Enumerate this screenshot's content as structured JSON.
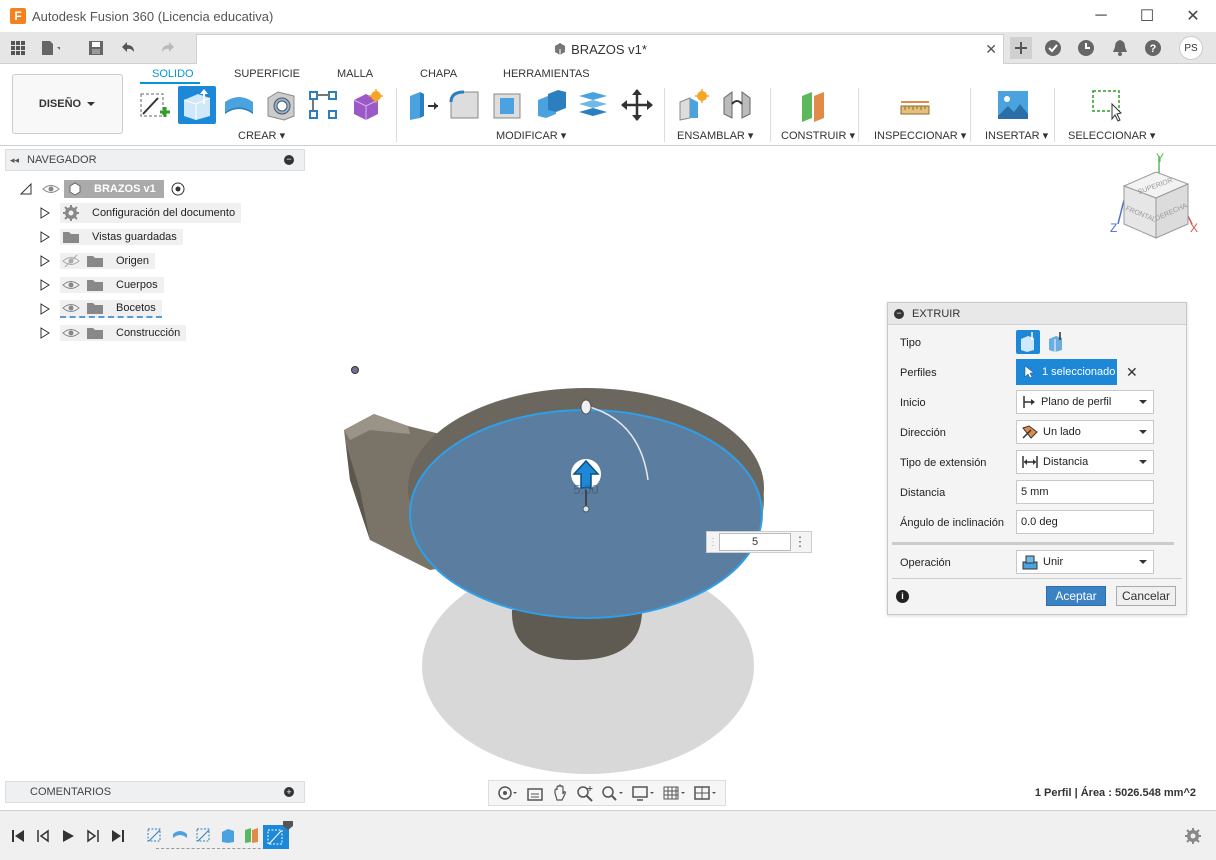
{
  "window": {
    "title": "Autodesk Fusion 360 (Licencia educativa)",
    "logo_letter": "F",
    "minimize": "─",
    "maximize": "☐",
    "close": "✕"
  },
  "tabbar": {
    "doc_title": "BRAZOS v1*",
    "user_initials": "PS"
  },
  "toolbar": {
    "design_label": "DISEÑO",
    "workspace_tabs": [
      "SOLIDO",
      "SUPERFICIE",
      "MALLA",
      "CHAPA",
      "HERRAMIENTAS"
    ],
    "groups": {
      "crear": "CREAR",
      "modificar": "MODIFICAR",
      "ensamblar": "ENSAMBLAR",
      "construir": "CONSTRUIR",
      "inspeccionar": "INSPECCIONAR",
      "insertar": "INSERTAR",
      "seleccionar": "SELECCIONAR"
    }
  },
  "browser": {
    "header": "NAVEGADOR",
    "root": "BRAZOS v1",
    "items": [
      {
        "label": "Configuración del documento"
      },
      {
        "label": "Vistas guardadas"
      },
      {
        "label": "Origen"
      },
      {
        "label": "Cuerpos"
      },
      {
        "label": "Bocetos"
      },
      {
        "label": "Construcción"
      }
    ]
  },
  "comments": {
    "header": "COMENTARIOS"
  },
  "viewcube": {
    "top": "SUPERIOR",
    "front": "FRONTAL",
    "right": "DERECHA",
    "axis_x": "X",
    "axis_y": "Y",
    "axis_z": "Z"
  },
  "canvas": {
    "value_input": "5",
    "faded_label": "5.00"
  },
  "extrude": {
    "title": "EXTRUIR",
    "tipo": "Tipo",
    "perfiles": "Perfiles",
    "perfiles_value": "1 seleccionado",
    "inicio": "Inicio",
    "inicio_value": "Plano de perfil",
    "direccion": "Dirección",
    "direccion_value": "Un lado",
    "tipo_extension": "Tipo de extensión",
    "tipo_extension_value": "Distancia",
    "distancia": "Distancia",
    "distancia_value": "5 mm",
    "angulo": "Ángulo de inclinación",
    "angulo_value": "0.0 deg",
    "operacion": "Operación",
    "operacion_value": "Unir",
    "accept": "Aceptar",
    "cancel": "Cancelar"
  },
  "status": {
    "text": "1 Perfil | Área : 5026.548 mm^2"
  },
  "colors": {
    "accent": "#0696d7",
    "selection_blue": "#1e88d8",
    "profile_fill": "#5b7da0"
  }
}
